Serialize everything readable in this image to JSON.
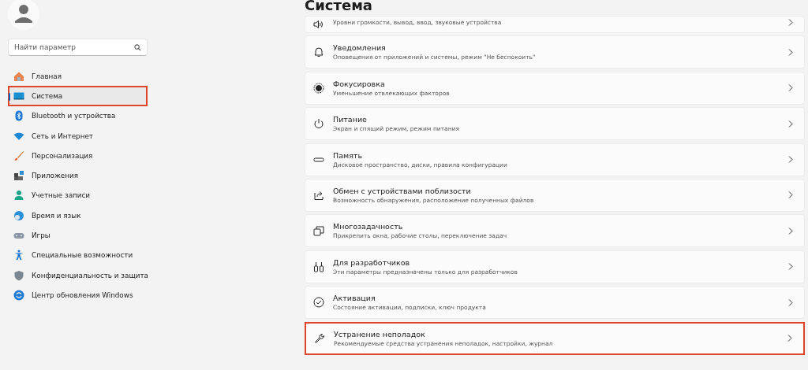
{
  "search": {
    "placeholder": "Найти параметр"
  },
  "nav": [
    {
      "label": "Главная",
      "selected": false,
      "highlighted": false
    },
    {
      "label": "Система",
      "selected": true,
      "highlighted": true
    },
    {
      "label": "Bluetooth и устройства",
      "selected": false,
      "highlighted": false
    },
    {
      "label": "Сеть и Интернет",
      "selected": false,
      "highlighted": false
    },
    {
      "label": "Персонализация",
      "selected": false,
      "highlighted": false
    },
    {
      "label": "Приложения",
      "selected": false,
      "highlighted": false
    },
    {
      "label": "Учетные записи",
      "selected": false,
      "highlighted": false
    },
    {
      "label": "Время и язык",
      "selected": false,
      "highlighted": false
    },
    {
      "label": "Игры",
      "selected": false,
      "highlighted": false
    },
    {
      "label": "Специальные возможности",
      "selected": false,
      "highlighted": false
    },
    {
      "label": "Конфиденциальность и защита",
      "selected": false,
      "highlighted": false
    },
    {
      "label": "Центр обновления Windows",
      "selected": false,
      "highlighted": false
    }
  ],
  "page_title": "Система",
  "settings": [
    {
      "description": "Уровни громкости, вывод, ввод, звуковые устройства",
      "highlighted": false
    },
    {
      "title": "Уведомления",
      "description": "Оповещения от приложений и системы, режим \"Не беспокоить\"",
      "highlighted": false
    },
    {
      "title": "Фокусировка",
      "description": "Уменьшение отвлекающих факторов",
      "highlighted": false
    },
    {
      "title": "Питание",
      "description": "Экран и спящий режим, режим питания",
      "highlighted": false
    },
    {
      "title": "Память",
      "description": "Дисковое пространство, диски, правила конфигурации",
      "highlighted": false
    },
    {
      "title": "Обмен с устройствами поблизости",
      "description": "Возможность обнаружения, расположение полученных файлов",
      "highlighted": false
    },
    {
      "title": "Многозадачность",
      "description": "Прикрепить окна, рабочие столы, переключение задач",
      "highlighted": false
    },
    {
      "title": "Для разработчиков",
      "description": "Эти параметры предназначены только для разработчиков",
      "highlighted": false
    },
    {
      "title": "Активация",
      "description": "Состояние активации, подписки, ключ продукта",
      "highlighted": false
    },
    {
      "title": "Устранение неполадок",
      "description": "Рекомендуемые средства устранения неполадок, настройки, журнал",
      "highlighted": true
    }
  ]
}
